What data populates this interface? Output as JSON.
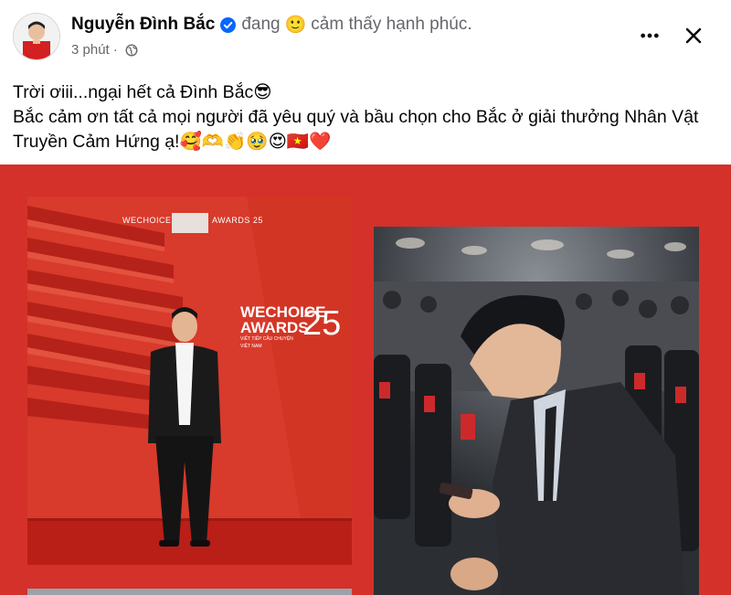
{
  "post": {
    "author": "Nguyễn Đình Bắc",
    "feeling_prefix": "đang",
    "feeling_emoji": "🙂",
    "feeling_text": "cảm thấy hạnh phúc.",
    "time": "3 phút",
    "separator": "·",
    "text_line1": "Trời ơiii...ngại hết cả Đình Bắc😎",
    "text_line2": "Bắc cảm ơn tất cả mọi người đã yêu quý và bầu chọn cho Bắc ở giải thưởng Nhân Vật Truyền Cảm Hứng ạ!🥰🫶👏🥹😍🇻🇳❤️"
  },
  "photo1": {
    "brand_left": "WECHOICE",
    "brand_right": "AWARDS 25",
    "logo_line1": "WECHOICE",
    "logo_line2": "AWARDS",
    "logo_num": "25",
    "tagline": "VIẾT TIẾP CÂU CHUYỆN VIỆT NAM"
  },
  "icons": {
    "verified": "verified-badge-icon",
    "globe": "globe-icon",
    "more": "more-options-icon",
    "close": "close-icon"
  },
  "colors": {
    "verified_blue": "#0866ff",
    "media_red": "#d4312a",
    "meta_gray": "#65676b"
  }
}
